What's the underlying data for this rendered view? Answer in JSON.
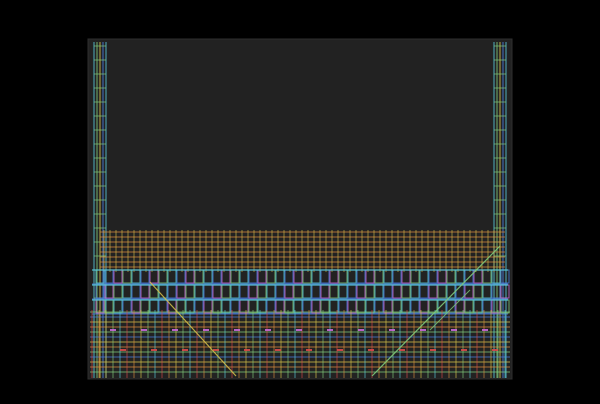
{
  "view": {
    "background_color": "#000000",
    "die_fill_color": "#222222",
    "die_border_color": "#2e2e2e"
  },
  "layers": [
    {
      "name": "metal-yellow",
      "color": "#d8c24a"
    },
    {
      "name": "metal-orange",
      "color": "#d98a3c"
    },
    {
      "name": "metal-green",
      "color": "#7fc97a"
    },
    {
      "name": "metal-cyan",
      "color": "#58c8d8"
    },
    {
      "name": "metal-blue",
      "color": "#4a7ee0"
    },
    {
      "name": "metal-magenta",
      "color": "#c86ad8"
    },
    {
      "name": "metal-red",
      "color": "#d84a4a"
    }
  ],
  "text": {}
}
